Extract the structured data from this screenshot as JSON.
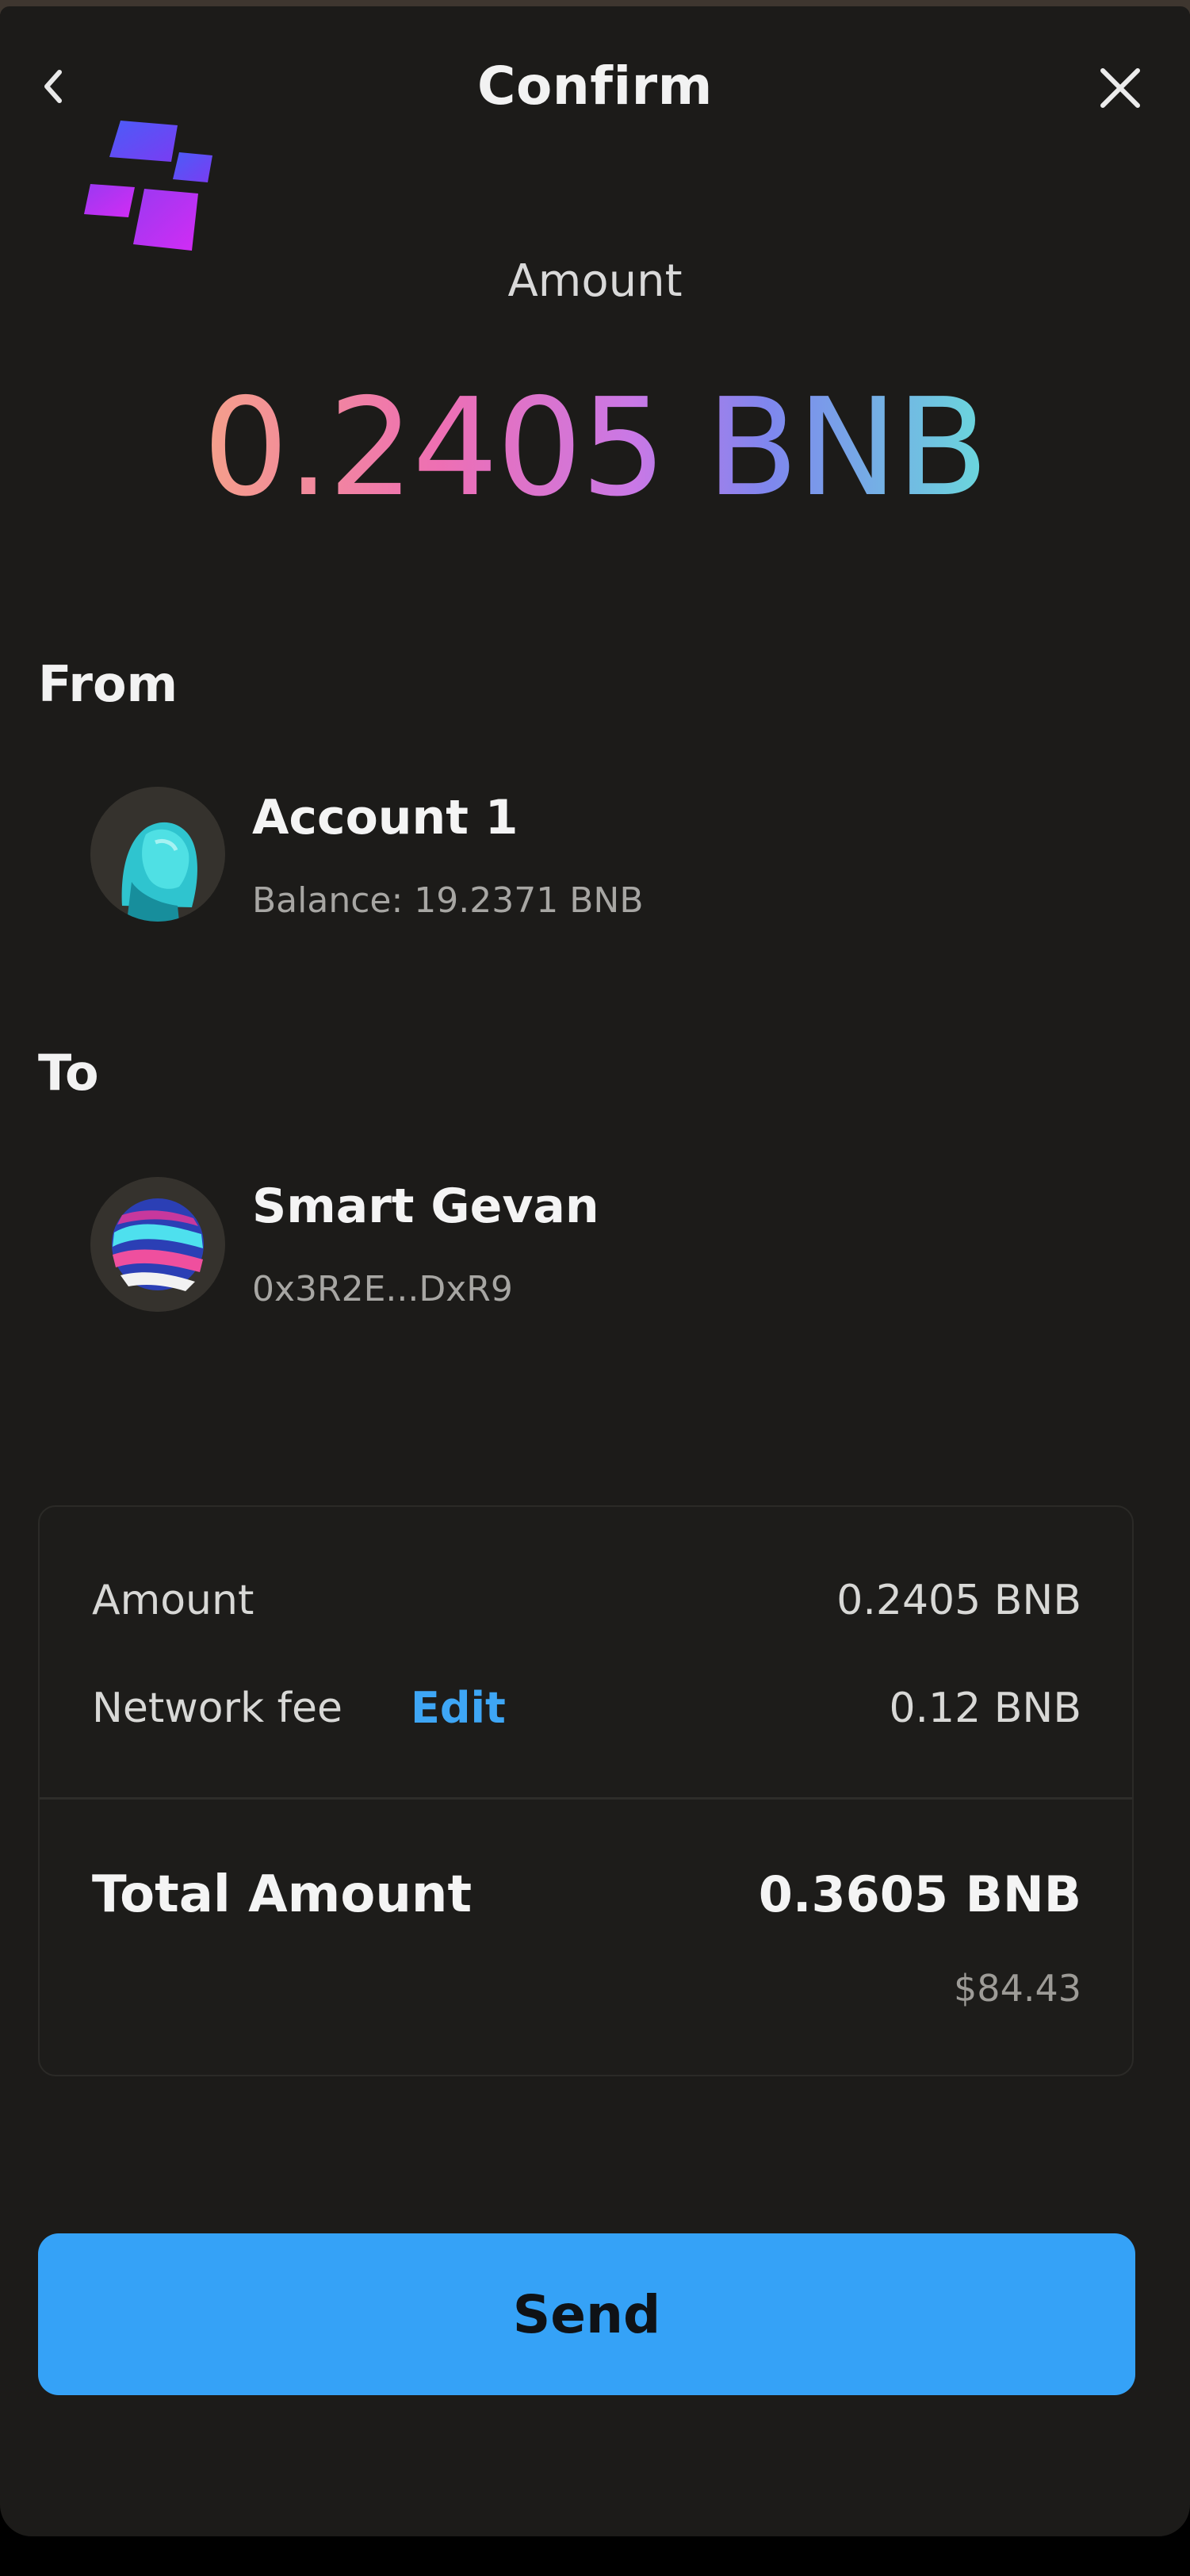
{
  "header": {
    "title": "Confirm",
    "back_icon": "chevron-left-icon",
    "close_icon": "close-icon"
  },
  "brand": {
    "logo_icon": "app-logo-icon",
    "colors": [
      "#4f5cf7",
      "#c52ef5"
    ]
  },
  "amount": {
    "label": "Amount",
    "value": "0.2405 BNB",
    "gradient": [
      "#f5a08a",
      "#ee6fb3",
      "#c978e6",
      "#7f86ee",
      "#6ad8dc"
    ]
  },
  "from": {
    "label": "From",
    "name": "Account 1",
    "balance": "Balance: 19.2371 BNB",
    "avatar_icon": "account-avatar-icon"
  },
  "to": {
    "label": "To",
    "name": "Smart Gevan",
    "address": "0x3R2E...DxR9",
    "avatar_icon": "recipient-avatar-icon"
  },
  "summary": {
    "amount_label": "Amount",
    "amount_value": "0.2405 BNB",
    "fee_label": "Network fee",
    "fee_edit": "Edit",
    "fee_value": "0.12 BNB",
    "total_label": "Total Amount",
    "total_value": "0.3605 BNB",
    "total_usd": "$84.43"
  },
  "actions": {
    "send_label": "Send",
    "send_color": "#35a2f7"
  }
}
